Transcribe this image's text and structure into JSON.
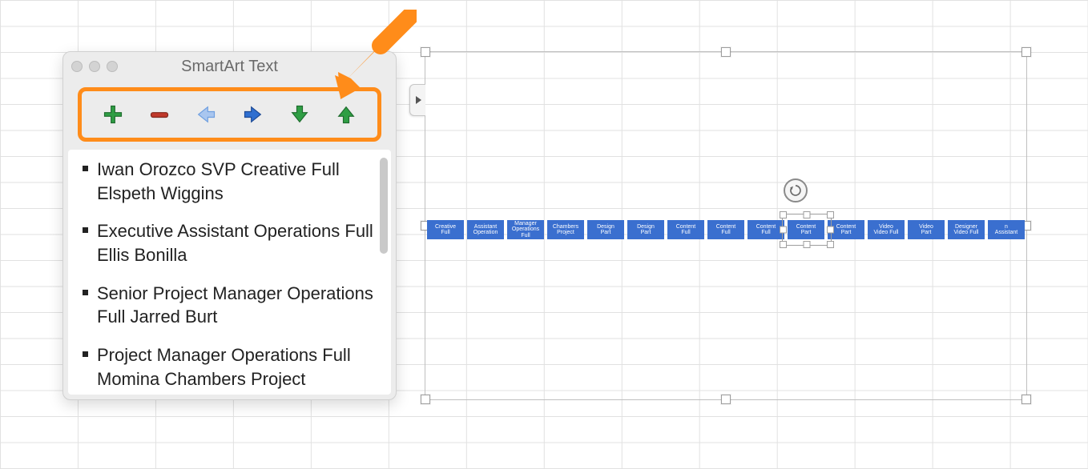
{
  "panel": {
    "title": "SmartArt Text",
    "tools": {
      "add": "add-shape",
      "remove": "remove-shape",
      "promote": "promote",
      "demote": "demote",
      "move_down": "move-down",
      "move_up": "move-up"
    },
    "items": [
      "Iwan Orozco  SVP Creative Full Elspeth Wiggins",
      "Executive Assistant Operations Full Ellis Bonilla",
      "Senior Project Manager Operations Full Jarred Burt",
      "Project Manager Operations Full Momina Chambers Project Specialist  Operations"
    ]
  },
  "smartart": {
    "nodes": [
      "Creative\nFull",
      "Assistant\nOperation",
      "Manager\nOperations Full",
      "Chambers\nProject",
      "Design\nPart",
      "Design\nPart",
      "Content\nFull",
      "Content\nFull",
      "Content\nFull",
      "Content\nPart",
      "Content\nPart",
      "Video\nVideo Full",
      "Video\nPart",
      "Designer\nVideo Full",
      "n\nAssistant"
    ],
    "selected_index": 9
  },
  "annotation": {
    "arrow_color": "#ff8c1a"
  }
}
